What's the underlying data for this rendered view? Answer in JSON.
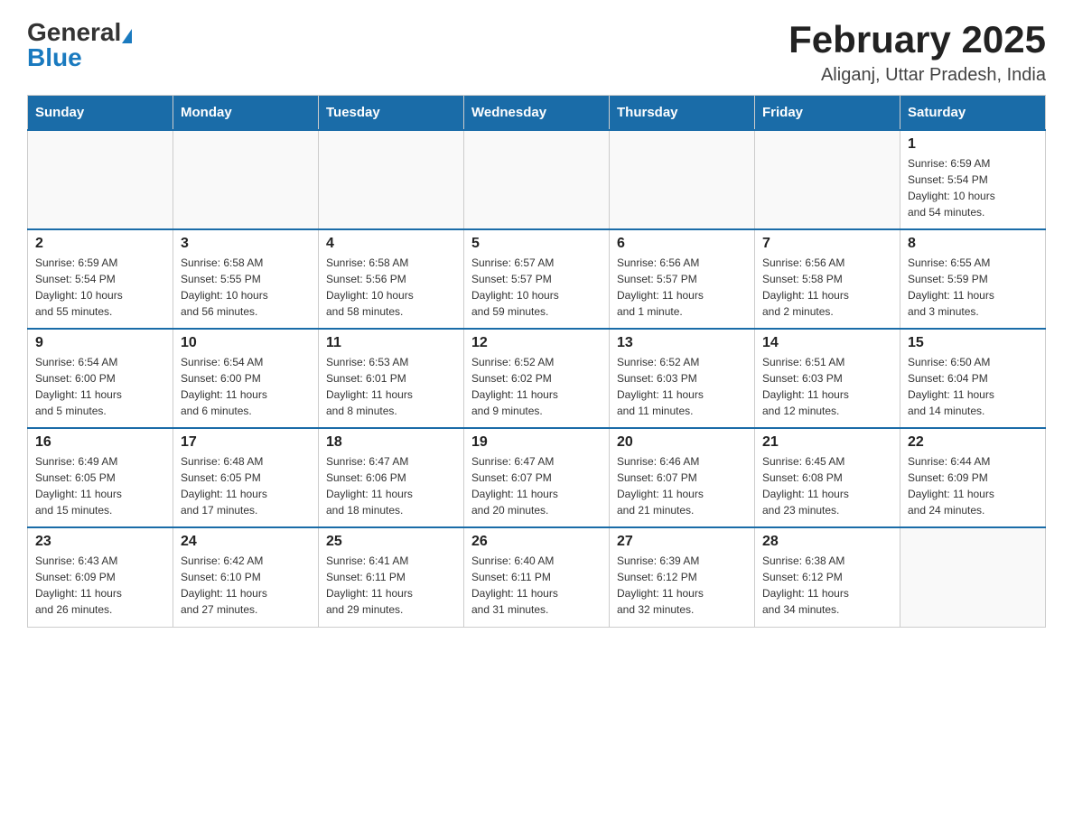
{
  "header": {
    "logo_general": "General",
    "logo_blue": "Blue",
    "title": "February 2025",
    "subtitle": "Aliganj, Uttar Pradesh, India"
  },
  "calendar": {
    "days_of_week": [
      "Sunday",
      "Monday",
      "Tuesday",
      "Wednesday",
      "Thursday",
      "Friday",
      "Saturday"
    ],
    "weeks": [
      {
        "days": [
          {
            "num": "",
            "info": ""
          },
          {
            "num": "",
            "info": ""
          },
          {
            "num": "",
            "info": ""
          },
          {
            "num": "",
            "info": ""
          },
          {
            "num": "",
            "info": ""
          },
          {
            "num": "",
            "info": ""
          },
          {
            "num": "1",
            "info": "Sunrise: 6:59 AM\nSunset: 5:54 PM\nDaylight: 10 hours\nand 54 minutes."
          }
        ]
      },
      {
        "days": [
          {
            "num": "2",
            "info": "Sunrise: 6:59 AM\nSunset: 5:54 PM\nDaylight: 10 hours\nand 55 minutes."
          },
          {
            "num": "3",
            "info": "Sunrise: 6:58 AM\nSunset: 5:55 PM\nDaylight: 10 hours\nand 56 minutes."
          },
          {
            "num": "4",
            "info": "Sunrise: 6:58 AM\nSunset: 5:56 PM\nDaylight: 10 hours\nand 58 minutes."
          },
          {
            "num": "5",
            "info": "Sunrise: 6:57 AM\nSunset: 5:57 PM\nDaylight: 10 hours\nand 59 minutes."
          },
          {
            "num": "6",
            "info": "Sunrise: 6:56 AM\nSunset: 5:57 PM\nDaylight: 11 hours\nand 1 minute."
          },
          {
            "num": "7",
            "info": "Sunrise: 6:56 AM\nSunset: 5:58 PM\nDaylight: 11 hours\nand 2 minutes."
          },
          {
            "num": "8",
            "info": "Sunrise: 6:55 AM\nSunset: 5:59 PM\nDaylight: 11 hours\nand 3 minutes."
          }
        ]
      },
      {
        "days": [
          {
            "num": "9",
            "info": "Sunrise: 6:54 AM\nSunset: 6:00 PM\nDaylight: 11 hours\nand 5 minutes."
          },
          {
            "num": "10",
            "info": "Sunrise: 6:54 AM\nSunset: 6:00 PM\nDaylight: 11 hours\nand 6 minutes."
          },
          {
            "num": "11",
            "info": "Sunrise: 6:53 AM\nSunset: 6:01 PM\nDaylight: 11 hours\nand 8 minutes."
          },
          {
            "num": "12",
            "info": "Sunrise: 6:52 AM\nSunset: 6:02 PM\nDaylight: 11 hours\nand 9 minutes."
          },
          {
            "num": "13",
            "info": "Sunrise: 6:52 AM\nSunset: 6:03 PM\nDaylight: 11 hours\nand 11 minutes."
          },
          {
            "num": "14",
            "info": "Sunrise: 6:51 AM\nSunset: 6:03 PM\nDaylight: 11 hours\nand 12 minutes."
          },
          {
            "num": "15",
            "info": "Sunrise: 6:50 AM\nSunset: 6:04 PM\nDaylight: 11 hours\nand 14 minutes."
          }
        ]
      },
      {
        "days": [
          {
            "num": "16",
            "info": "Sunrise: 6:49 AM\nSunset: 6:05 PM\nDaylight: 11 hours\nand 15 minutes."
          },
          {
            "num": "17",
            "info": "Sunrise: 6:48 AM\nSunset: 6:05 PM\nDaylight: 11 hours\nand 17 minutes."
          },
          {
            "num": "18",
            "info": "Sunrise: 6:47 AM\nSunset: 6:06 PM\nDaylight: 11 hours\nand 18 minutes."
          },
          {
            "num": "19",
            "info": "Sunrise: 6:47 AM\nSunset: 6:07 PM\nDaylight: 11 hours\nand 20 minutes."
          },
          {
            "num": "20",
            "info": "Sunrise: 6:46 AM\nSunset: 6:07 PM\nDaylight: 11 hours\nand 21 minutes."
          },
          {
            "num": "21",
            "info": "Sunrise: 6:45 AM\nSunset: 6:08 PM\nDaylight: 11 hours\nand 23 minutes."
          },
          {
            "num": "22",
            "info": "Sunrise: 6:44 AM\nSunset: 6:09 PM\nDaylight: 11 hours\nand 24 minutes."
          }
        ]
      },
      {
        "days": [
          {
            "num": "23",
            "info": "Sunrise: 6:43 AM\nSunset: 6:09 PM\nDaylight: 11 hours\nand 26 minutes."
          },
          {
            "num": "24",
            "info": "Sunrise: 6:42 AM\nSunset: 6:10 PM\nDaylight: 11 hours\nand 27 minutes."
          },
          {
            "num": "25",
            "info": "Sunrise: 6:41 AM\nSunset: 6:11 PM\nDaylight: 11 hours\nand 29 minutes."
          },
          {
            "num": "26",
            "info": "Sunrise: 6:40 AM\nSunset: 6:11 PM\nDaylight: 11 hours\nand 31 minutes."
          },
          {
            "num": "27",
            "info": "Sunrise: 6:39 AM\nSunset: 6:12 PM\nDaylight: 11 hours\nand 32 minutes."
          },
          {
            "num": "28",
            "info": "Sunrise: 6:38 AM\nSunset: 6:12 PM\nDaylight: 11 hours\nand 34 minutes."
          },
          {
            "num": "",
            "info": ""
          }
        ]
      }
    ]
  }
}
